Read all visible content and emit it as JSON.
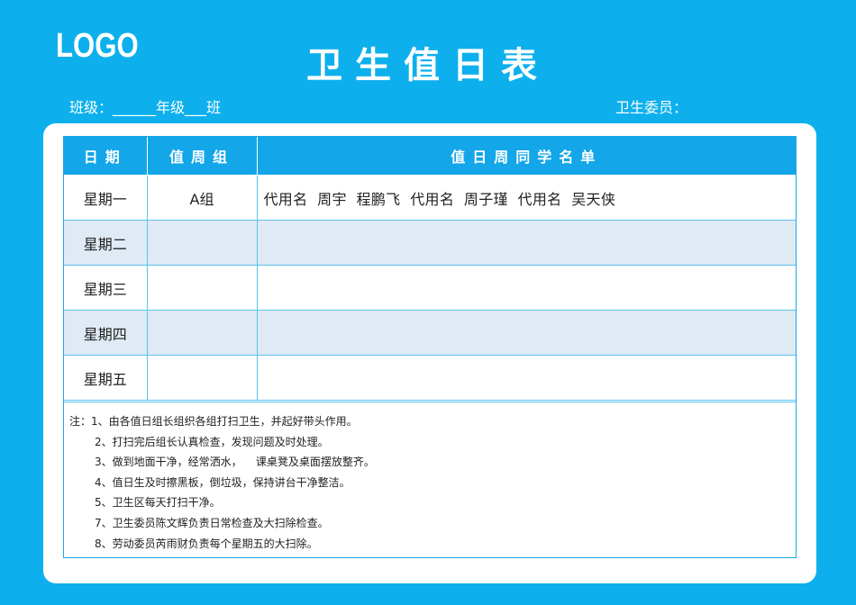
{
  "header": {
    "logo": "LOGO",
    "title": "卫生值日表",
    "class_label": "班级：______年级___班",
    "hygiene_committee_label": "卫生委员："
  },
  "table": {
    "columns": [
      "日期",
      "值周组",
      "值日周同学名单"
    ],
    "rows": [
      {
        "day": "星期一",
        "group": "A组",
        "names": "代用名  周宇  程鹏飞  代用名  周子瑾  代用名  吴天侠"
      },
      {
        "day": "星期二",
        "group": "",
        "names": ""
      },
      {
        "day": "星期三",
        "group": "",
        "names": ""
      },
      {
        "day": "星期四",
        "group": "",
        "names": ""
      },
      {
        "day": "星期五",
        "group": "",
        "names": ""
      }
    ]
  },
  "notes": [
    "注：1、由各值日组长组织各组打扫卫生，并起好带头作用。",
    "2、打扫完后组长认真检查，发现问题及时处理。",
    "3、做到地面干净，经常洒水，    课桌凳及桌面摆放整齐。",
    "4、值日生及时擦黑板，倒垃圾，保持讲台干净整洁。",
    "5、卫生区每天打扫干净。",
    "7、卫生委员陈文辉负责日常检查及大扫除检查。",
    "8、劳动委员芮雨财负责每个星期五的大扫除。"
  ],
  "colors": {
    "background": "#0db0ec",
    "header_row": "#13a6e8",
    "alt_row": "#dfeaf5"
  }
}
